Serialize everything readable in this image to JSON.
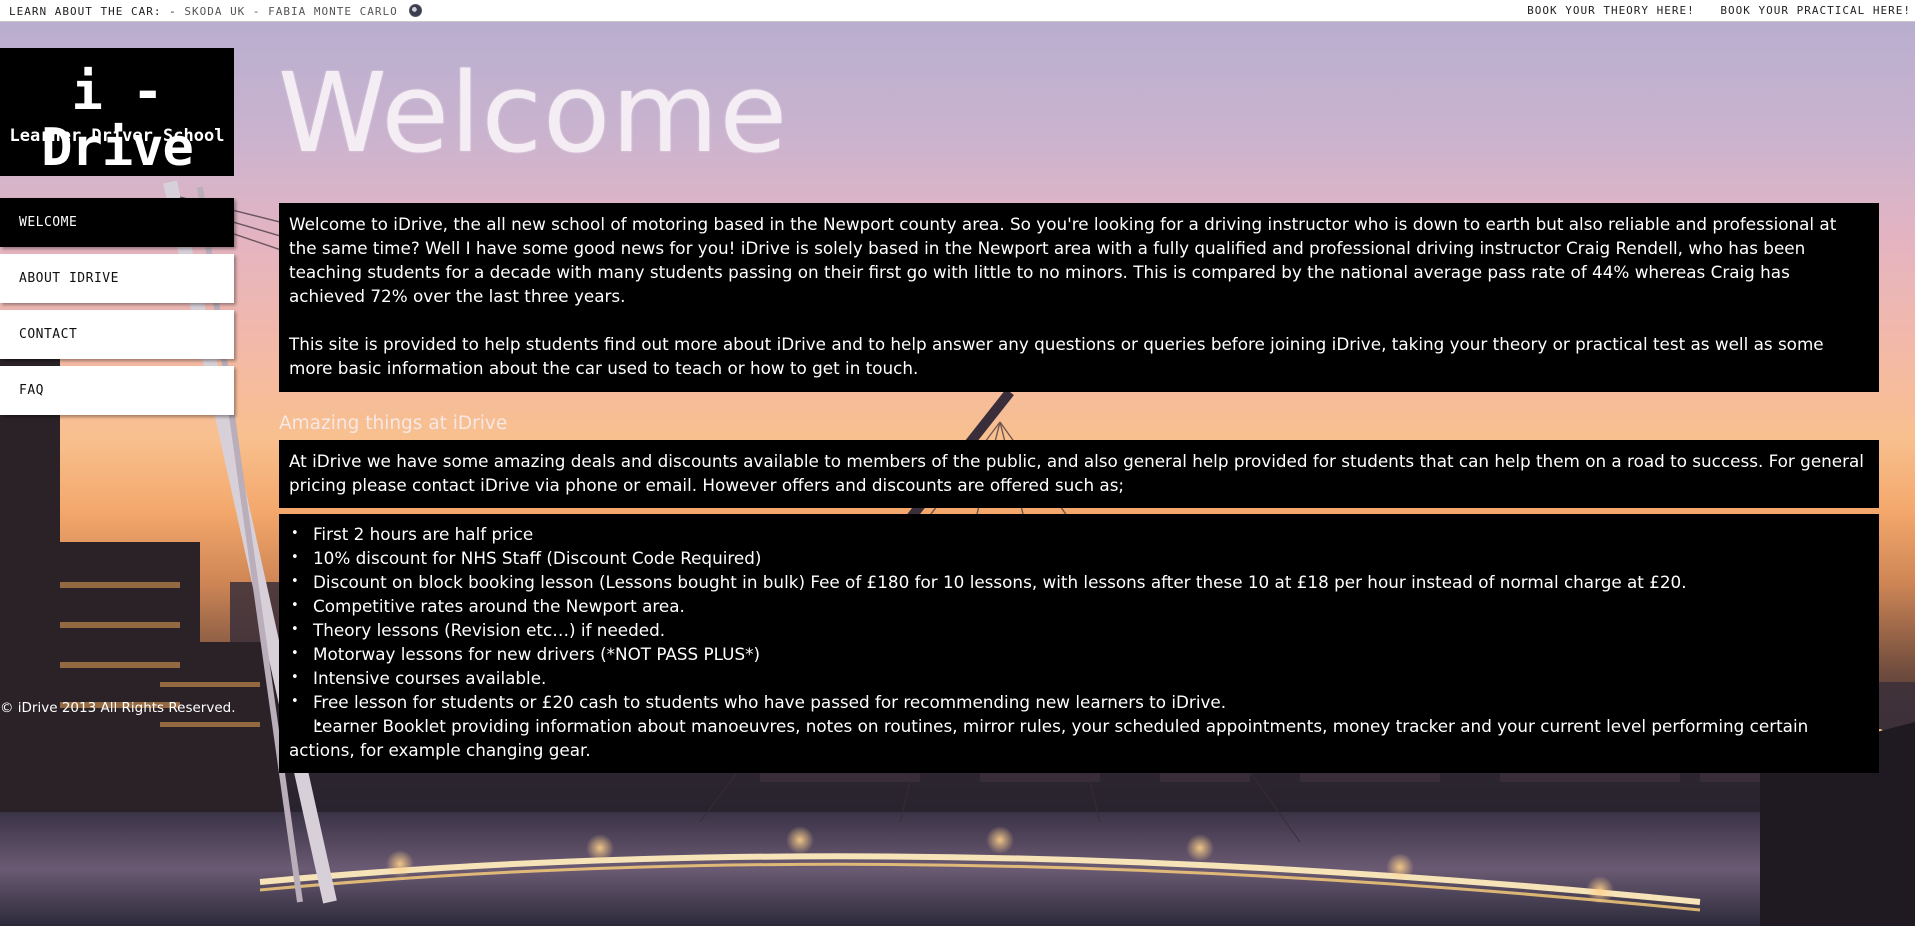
{
  "topbar": {
    "left_label": "LEARN ABOUT THE CAR: -",
    "left_link": "SKODA UK - FABIA MONTE CARLO",
    "right_links": [
      "BOOK YOUR THEORY HERE!",
      "BOOK YOUR PRACTICAL HERE!"
    ]
  },
  "logo": {
    "brand": "i - Drive",
    "tagline": "Learner Driver School"
  },
  "nav": {
    "items": [
      "WELCOME",
      "ABOUT IDRIVE",
      "CONTACT",
      "FAQ"
    ],
    "active": "WELCOME"
  },
  "footer": {
    "copyright": "© iDrive 2013 All Rights Reserved."
  },
  "main": {
    "title": "Welcome",
    "intro": [
      "Welcome to iDrive, the all new school of motoring based in the Newport county area. So you're looking for a driving instructor who is down to earth but also reliable and professional at the same time? Well I have some good news for you! iDrive is solely based in the Newport area with a fully qualified and professional driving instructor Craig Rendell, who has been teaching students for a decade with many students passing on their first go with little to no minors. This is compared by the national average pass rate of 44% whereas Craig has achieved 72% over the last three years.",
      "This site is provided to help students find out more about iDrive and to help answer any questions or queries before joining iDrive, taking your theory or practical test as well as some more basic information about the car used to teach or how to get in touch."
    ],
    "subheading": "Amazing things at iDrive",
    "offers_intro": "At iDrive we have some amazing deals and discounts available to members of the public, and also general help provided for students that can help them on a road to success. For general pricing please contact iDrive via phone or email. However offers and discounts are offered such as;",
    "offers": [
      "First 2 hours are half price",
      "10% discount for NHS Staff (Discount Code Required)",
      "Discount on block booking lesson (Lessons bought in bulk) Fee of £180 for 10 lessons, with lessons after these 10 at £18 per hour instead of normal charge at £20.",
      "Competitive rates around the Newport area.",
      "Theory lessons (Revision etc…) if needed.",
      "Motorway lessons for new drivers (*NOT PASS PLUS*)",
      "Intensive courses available.",
      "Free lesson for students or £20 cash to students who have passed for recommending new learners to iDrive.",
      "Learner Booklet providing information about manoeuvres, notes on routines, mirror rules, your scheduled appointments, money tracker and your current level performing certain actions, for example changing gear."
    ]
  },
  "icons": {
    "topbar_globe": "globe-icon"
  },
  "colors": {
    "panel": "#000000",
    "text_on_panel": "#ffffff",
    "nav_bg": "#ffffff",
    "nav_active_bg": "#000000"
  }
}
